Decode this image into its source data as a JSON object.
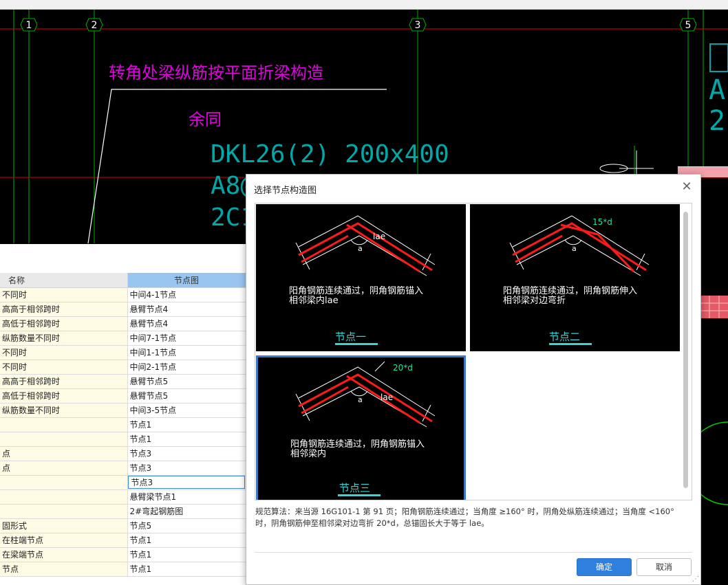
{
  "cad": {
    "axis_labels": [
      "1",
      "2",
      "3",
      "5"
    ],
    "magenta_title": "转角处梁纵筋按平面折梁构造",
    "magenta_note": "余同",
    "beam_label_line1": "DKL26(2) 200x400",
    "beam_label_line2": "A8@",
    "beam_label_line3": "2C1",
    "right_frag_a": "A",
    "right_frag_b": "2",
    "colors": {
      "grid_green": "#00b000",
      "cad_red": "#e00000",
      "magenta": "#e000e0",
      "cyan_text": "#00a8a8"
    }
  },
  "property_table": {
    "headers": {
      "name": "名称",
      "node": "节点图"
    },
    "rows": [
      {
        "name": "不同时",
        "node": "中间4-1节点"
      },
      {
        "name": "高高于相邻跨时",
        "node": "悬臂节点4"
      },
      {
        "name": "高低于相邻跨时",
        "node": "悬臂节点4"
      },
      {
        "name": "纵筋数量不同时",
        "node": "中间7-1节点"
      },
      {
        "name": "不同时",
        "node": "中间1-1节点"
      },
      {
        "name": "不同时",
        "node": "中间2-1节点"
      },
      {
        "name": "高高于相邻跨时",
        "node": "悬臂节点5"
      },
      {
        "name": "高低于相邻跨时",
        "node": "悬臂节点5"
      },
      {
        "name": "纵筋数量不同时",
        "node": "中间3-5节点"
      },
      {
        "name": "",
        "node": "节点1"
      },
      {
        "name": "",
        "node": "节点1"
      },
      {
        "name": "点",
        "node": "节点3"
      },
      {
        "name": "点",
        "node": "节点3"
      },
      {
        "name": "",
        "node": "节点3"
      },
      {
        "name": "",
        "node": "悬臂梁节点1"
      },
      {
        "name": "",
        "node": "2#弯起钢筋图"
      },
      {
        "name": "固形式",
        "node": "节点5"
      },
      {
        "name": "在柱端节点",
        "node": "节点1"
      },
      {
        "name": "在梁端节点",
        "node": "节点1"
      },
      {
        "name": "节点",
        "node": "节点1"
      }
    ]
  },
  "dialog": {
    "title": "选择节点构造图",
    "close_icon": "close-icon",
    "options": [
      {
        "desc1": "阳角钢筋连续通过，阴角钢筋锚入",
        "desc2": "相邻梁内lae",
        "label": "节点一",
        "dim": "lae",
        "angle": "a"
      },
      {
        "desc1": "阳角钢筋连续通过，阴角钢筋伸入",
        "desc2": "相邻梁对边弯折",
        "label": "节点二",
        "dim": "15*d",
        "angle": "a"
      },
      {
        "desc1": "阳角钢筋连续通过，阴角钢筋锚入",
        "desc2": "相邻梁内",
        "label": "节点三",
        "dim": "20*d",
        "dim2": "lae",
        "angle": "a"
      }
    ],
    "selected_index": 2,
    "rule_line1": "规范算法：来当源 16G101-1 第 91 页；阳角钢筋连续通过；当角度 ≥160° 时，阴角处纵筋连续通过；当角度 <160°",
    "rule_line2": "时，阴角钢筋伸至相邻梁对边弯折 20*d，总锚固长大于等于 lae。",
    "ok_label": "确定",
    "cancel_label": "取消",
    "colors": {
      "accent": "#2f80de",
      "caption": "#35d6d6",
      "rebar_red": "#ff1a1a"
    }
  }
}
